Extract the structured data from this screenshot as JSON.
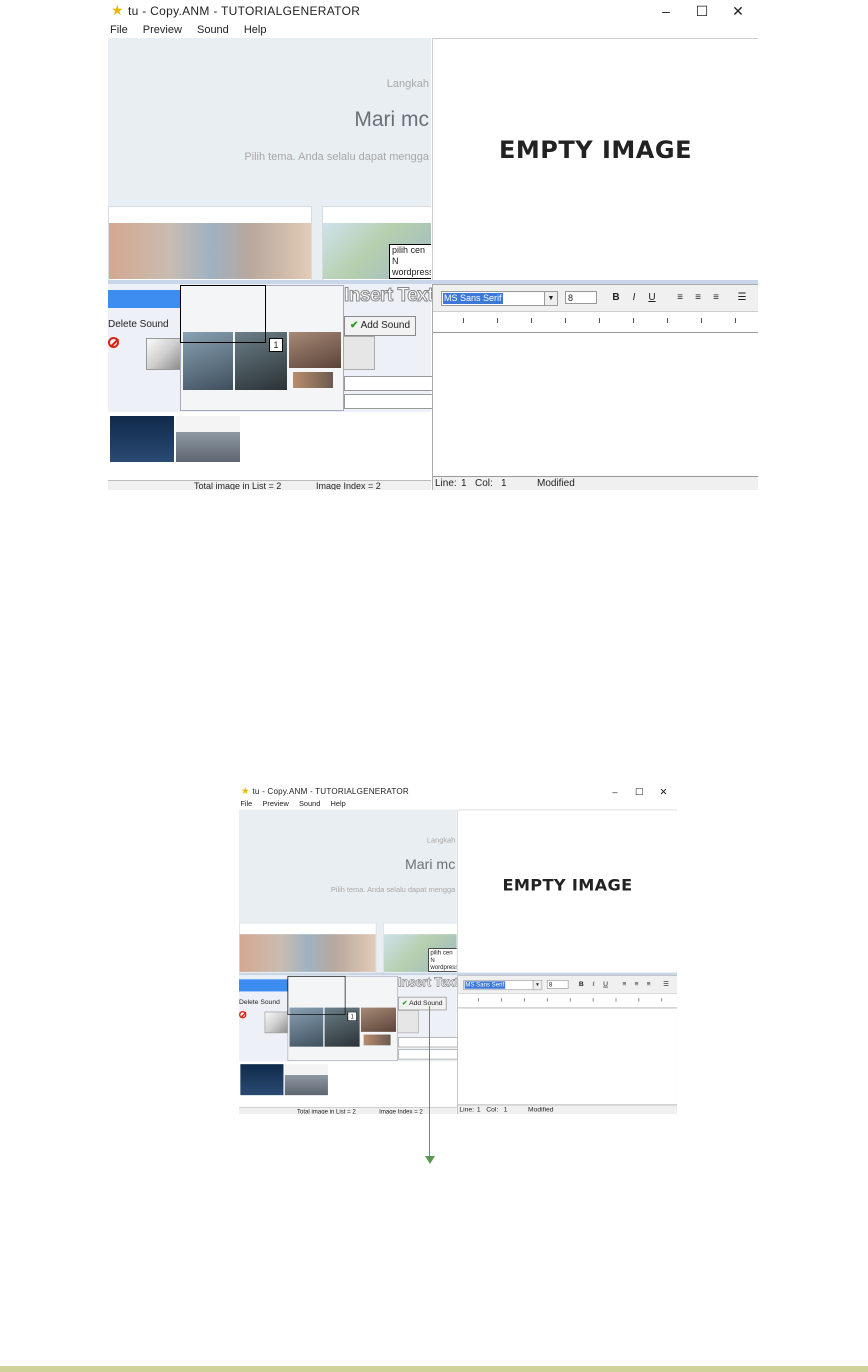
{
  "window": {
    "title": "tu - Copy.ANM - TUTORIALGENERATOR",
    "controls": [
      "minimize",
      "maximize",
      "close"
    ]
  },
  "menu": [
    "File",
    "Preview",
    "Sound",
    "Help"
  ],
  "preview": {
    "line1": "Langkah",
    "line2": "Mari mc",
    "line3": "Pilih tema. Anda selalu dapat mengga",
    "tooltip_line1": "pilih cen N",
    "tooltip_line2": "wordpress"
  },
  "empty_image_label": "EMPTY IMAGE",
  "left_panel": {
    "delete_sound": "Delete Sound",
    "insert_text": "Insert Text",
    "add_sound": "Add Sound",
    "badge": "1"
  },
  "status": {
    "total_images": "Total image in List = 2",
    "image_index": "Image Index = 2"
  },
  "editor": {
    "font": "MS Sans Serif",
    "size": "8",
    "bold": "B",
    "italic": "I",
    "underline": "U",
    "line_label": "Line:",
    "line_value": "1",
    "col_label": "Col:",
    "col_value": "1",
    "modified": "Modified"
  },
  "colors": {
    "accent_blue": "#3d8cf0",
    "arrow_green": "#5a9a4a",
    "delete_red": "#d21"
  }
}
